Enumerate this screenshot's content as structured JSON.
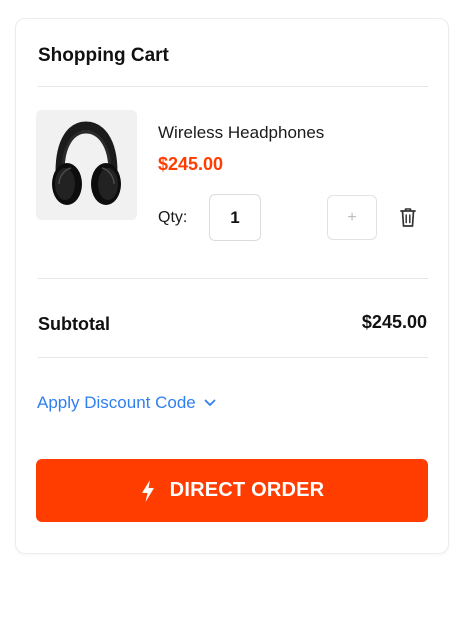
{
  "cart": {
    "title": "Shopping Cart"
  },
  "item": {
    "image_icon": "headphones-image",
    "name": "Wireless Headphones",
    "price": "$245.00",
    "qty_label": "Qty:",
    "qty_value": "1",
    "increment_label": "+",
    "remove_icon": "trash-icon"
  },
  "summary": {
    "subtotal_label": "Subtotal",
    "subtotal_value": "$245.00"
  },
  "discount": {
    "label": "Apply Discount Code",
    "icon": "chevron-down-icon"
  },
  "order_button": {
    "label": "DIRECT ORDER",
    "icon": "lightning-icon"
  },
  "colors": {
    "accent": "#ff3d00",
    "link": "#2f7ff0",
    "text": "#111111",
    "divider": "#e6e6e6"
  }
}
